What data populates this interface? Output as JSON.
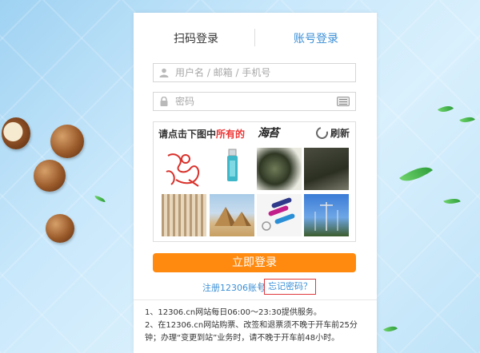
{
  "tabs": {
    "qr_login": "扫码登录",
    "account_login": "账号登录"
  },
  "form": {
    "username_placeholder": "用户名 / 邮箱 / 手机号",
    "password_placeholder": "密码"
  },
  "captcha": {
    "prompt_prefix": "请点击下图中",
    "prompt_highlight": "所有的",
    "target_word": "海苔",
    "refresh_label": "刷新",
    "images": [
      "paper-cut",
      "usb-stick",
      "seaweed",
      "seaweed-sheet",
      "sticks",
      "pyramids",
      "keychains",
      "street-lights"
    ]
  },
  "actions": {
    "login_label": "立即登录",
    "register_label": "注册12306账号",
    "separator": "|",
    "forgot_label": "忘记密码？"
  },
  "notice": {
    "line1": "1、12306.cn网站每日06:00～23:30提供服务。",
    "line2": "2、在12306.cn网站购票、改签和退票须不晚于开车前25分钟；办理“变更到站”业务时，请不晚于开车前48小时。"
  },
  "colors": {
    "accent_blue": "#3b8fd6",
    "login_orange": "#ff8a0f",
    "highlight_red": "#e33333",
    "forgot_border": "#e0393e"
  }
}
